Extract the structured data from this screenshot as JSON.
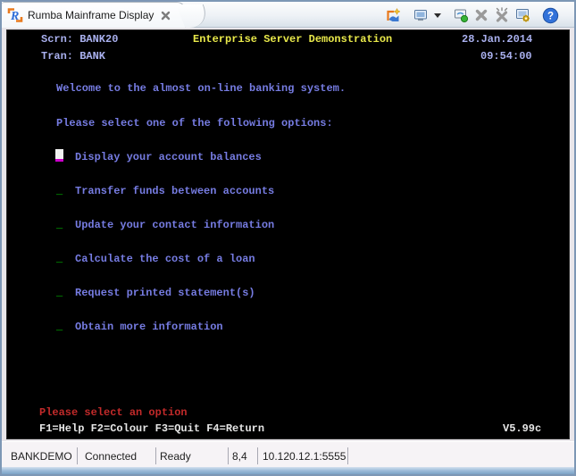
{
  "window": {
    "tab_title": "Rumba Mainframe Display"
  },
  "toolbar": {
    "icons": [
      "new-display",
      "display",
      "display-dropdown",
      "connect",
      "disconnect",
      "disconnect-all",
      "display-settings",
      "help"
    ]
  },
  "terminal": {
    "field_char": "_",
    "header": {
      "scrn": "Scrn: BANK20",
      "title": "Enterprise Server Demonstration",
      "date": "28.Jan.2014",
      "tran": "Tran: BANK",
      "time": "09:54:00"
    },
    "welcome": "Welcome to the almost on-line banking system.",
    "prompt": "Please select one of the following options:",
    "options": [
      "Display your account balances",
      "Transfer funds between accounts",
      "Update your contact information",
      "Calculate the cost of a loan",
      "Request printed statement(s)",
      "Obtain more information"
    ],
    "message": "Please select an option",
    "function_keys": "F1=Help F2=Colour F3=Quit F4=Return",
    "version": "V5.99c",
    "colors": {
      "background": "#000000",
      "header_text": "#a9b0ee",
      "title_text": "#e8e84a",
      "body_text": "#767ce2",
      "field_text": "#00cc00",
      "cursor_block": "#f2f2f2",
      "cursor_underline": "#cc00cc",
      "message_text": "#c22a2a",
      "fkeys_text": "#e6e6e6"
    }
  },
  "statusbar": {
    "session_name": "BANKDEMO",
    "connection_status": "Connected",
    "ready_status": "Ready",
    "cursor_position": "8,4",
    "host_address": "10.120.12.1:5555"
  }
}
